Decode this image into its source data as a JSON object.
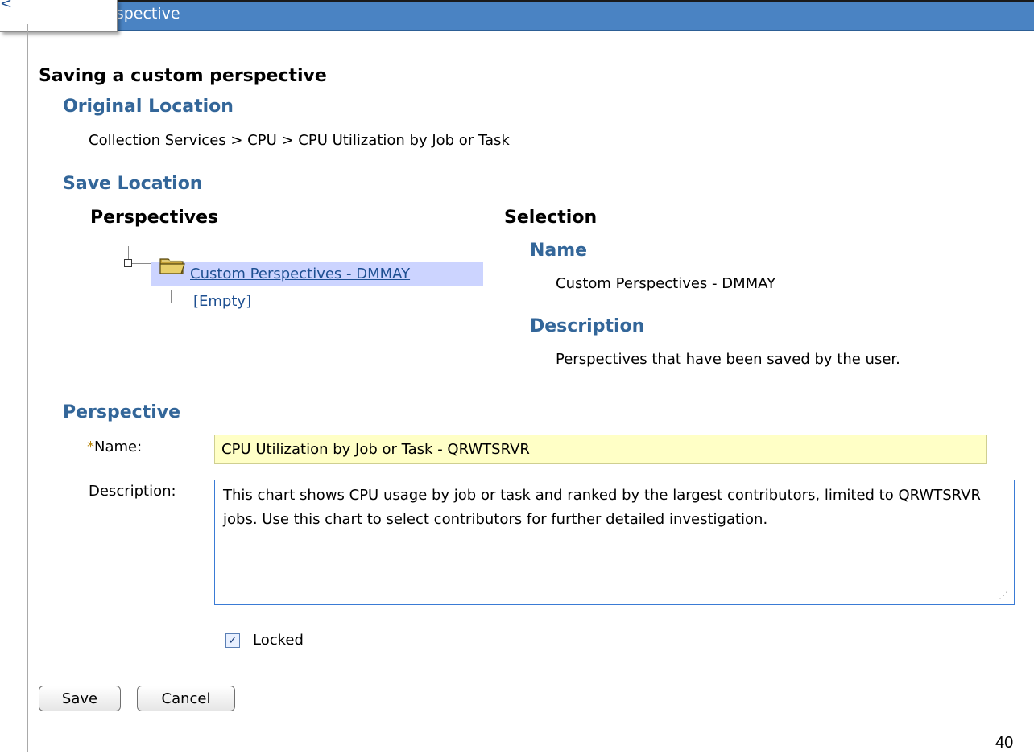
{
  "window": {
    "title": "rspective",
    "popup_glyph": "<"
  },
  "header": {
    "title": "Saving a custom perspective"
  },
  "original_location": {
    "heading": "Original Location",
    "path": "Collection Services > CPU > CPU Utilization by Job or Task"
  },
  "save_location": {
    "heading": "Save Location",
    "perspectives": {
      "heading": "Perspectives",
      "tree": {
        "expander_icon": "tree-expander-icon",
        "folder_icon": "folder-icon",
        "root_label": "Custom Perspectives - DMMAY",
        "child_label": "[Empty]"
      }
    },
    "selection": {
      "heading": "Selection",
      "name_heading": "Name",
      "name_value": "Custom Perspectives - DMMAY",
      "description_heading": "Description",
      "description_value": "Perspectives that have been saved by the user."
    }
  },
  "perspective": {
    "heading": "Perspective",
    "required_marker": "*",
    "name_label": "Name:",
    "name_value": "CPU Utilization by Job or Task - QRWTSRVR",
    "description_label": "Description:",
    "description_value": "This chart shows CPU usage by job or task and ranked by the largest contributors, limited to QRWTSRVR jobs. Use this chart to select contributors for further detailed investigation.",
    "locked_label": "Locked",
    "locked_checked": true
  },
  "buttons": {
    "save": "Save",
    "cancel": "Cancel"
  },
  "page_number": "40",
  "colors": {
    "titlebar": "#4a83c3",
    "heading_blue": "#336699",
    "selection_bg": "#ccd4ff",
    "name_field_bg": "#ffffc6"
  }
}
